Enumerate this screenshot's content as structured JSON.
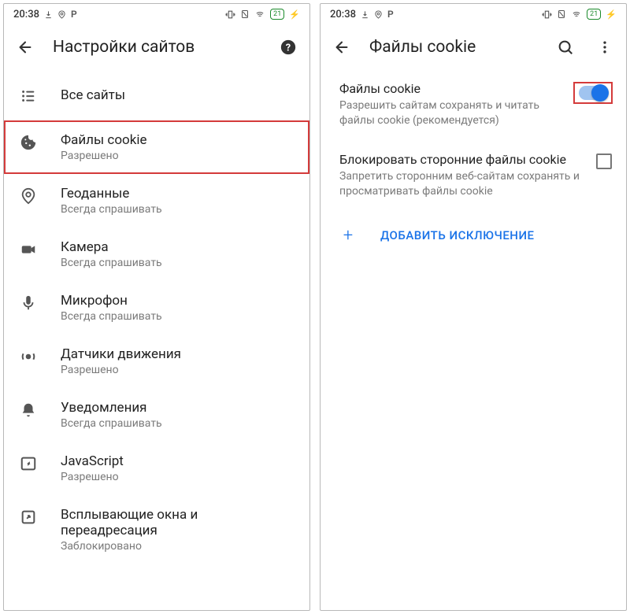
{
  "status": {
    "time": "20:38",
    "battery": "21"
  },
  "left": {
    "header": {
      "title": "Настройки сайтов"
    },
    "items": [
      {
        "icon": "list-icon",
        "primary": "Все сайты",
        "secondary": ""
      },
      {
        "icon": "cookie-icon",
        "primary": "Файлы cookie",
        "secondary": "Разрешено"
      },
      {
        "icon": "location-icon",
        "primary": "Геоданные",
        "secondary": "Всегда спрашивать"
      },
      {
        "icon": "camera-icon",
        "primary": "Камера",
        "secondary": "Всегда спрашивать"
      },
      {
        "icon": "mic-icon",
        "primary": "Микрофон",
        "secondary": "Всегда спрашивать"
      },
      {
        "icon": "motion-icon",
        "primary": "Датчики движения",
        "secondary": "Разрешено"
      },
      {
        "icon": "bell-icon",
        "primary": "Уведомления",
        "secondary": "Всегда спрашивать"
      },
      {
        "icon": "js-icon",
        "primary": "JavaScript",
        "secondary": "Разрешено"
      },
      {
        "icon": "popup-icon",
        "primary": "Всплывающие окна и переадресация",
        "secondary": "Заблокировано"
      }
    ]
  },
  "right": {
    "header": {
      "title": "Файлы cookie"
    },
    "settings": [
      {
        "primary": "Файлы cookie",
        "secondary": "Разрешить сайтам сохранять и читать файлы cookie (рекомендуется)",
        "control": "toggle_on"
      },
      {
        "primary": "Блокировать сторонние файлы cookie",
        "secondary": "Запретить сторонним веб-сайтам сохранять и просматривать файлы cookie",
        "control": "checkbox_off"
      }
    ],
    "add_label": "ДОБАВИТЬ ИСКЛЮЧЕНИЕ"
  }
}
